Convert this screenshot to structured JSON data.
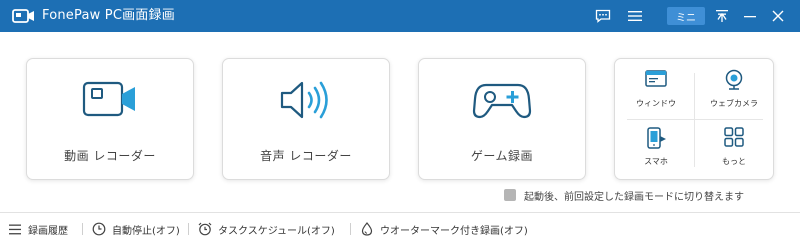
{
  "titlebar": {
    "title": "FonePaw PC画面録画",
    "mini_label": "ミニ"
  },
  "cards": {
    "video": {
      "label": "動画 レコーダー",
      "icon": "video-camera-icon"
    },
    "audio": {
      "label": "音声 レコーダー",
      "icon": "speaker-icon"
    },
    "game": {
      "label": "ゲーム録画",
      "icon": "gamepad-icon"
    }
  },
  "tiles": {
    "window": {
      "label": "ウィンドウ",
      "icon": "window-icon"
    },
    "webcam": {
      "label": "ウェブカメラ",
      "icon": "webcam-icon"
    },
    "phone": {
      "label": "スマホ",
      "icon": "phone-icon"
    },
    "more": {
      "label": "もっと",
      "icon": "grid-icon"
    }
  },
  "remember": {
    "label": "起動後、前回設定した録画モードに切り替えます",
    "checked": false
  },
  "footer": {
    "history": "録画履歴",
    "autostop": "自動停止(オフ)",
    "schedule": "タスクスケジュール(オフ)",
    "watermark": "ウオーターマーク付き録画(オフ)"
  },
  "colors": {
    "titlebar": "#1d6fb4",
    "accent": "#1a6aa8",
    "icon_dark": "#1f5a80"
  }
}
